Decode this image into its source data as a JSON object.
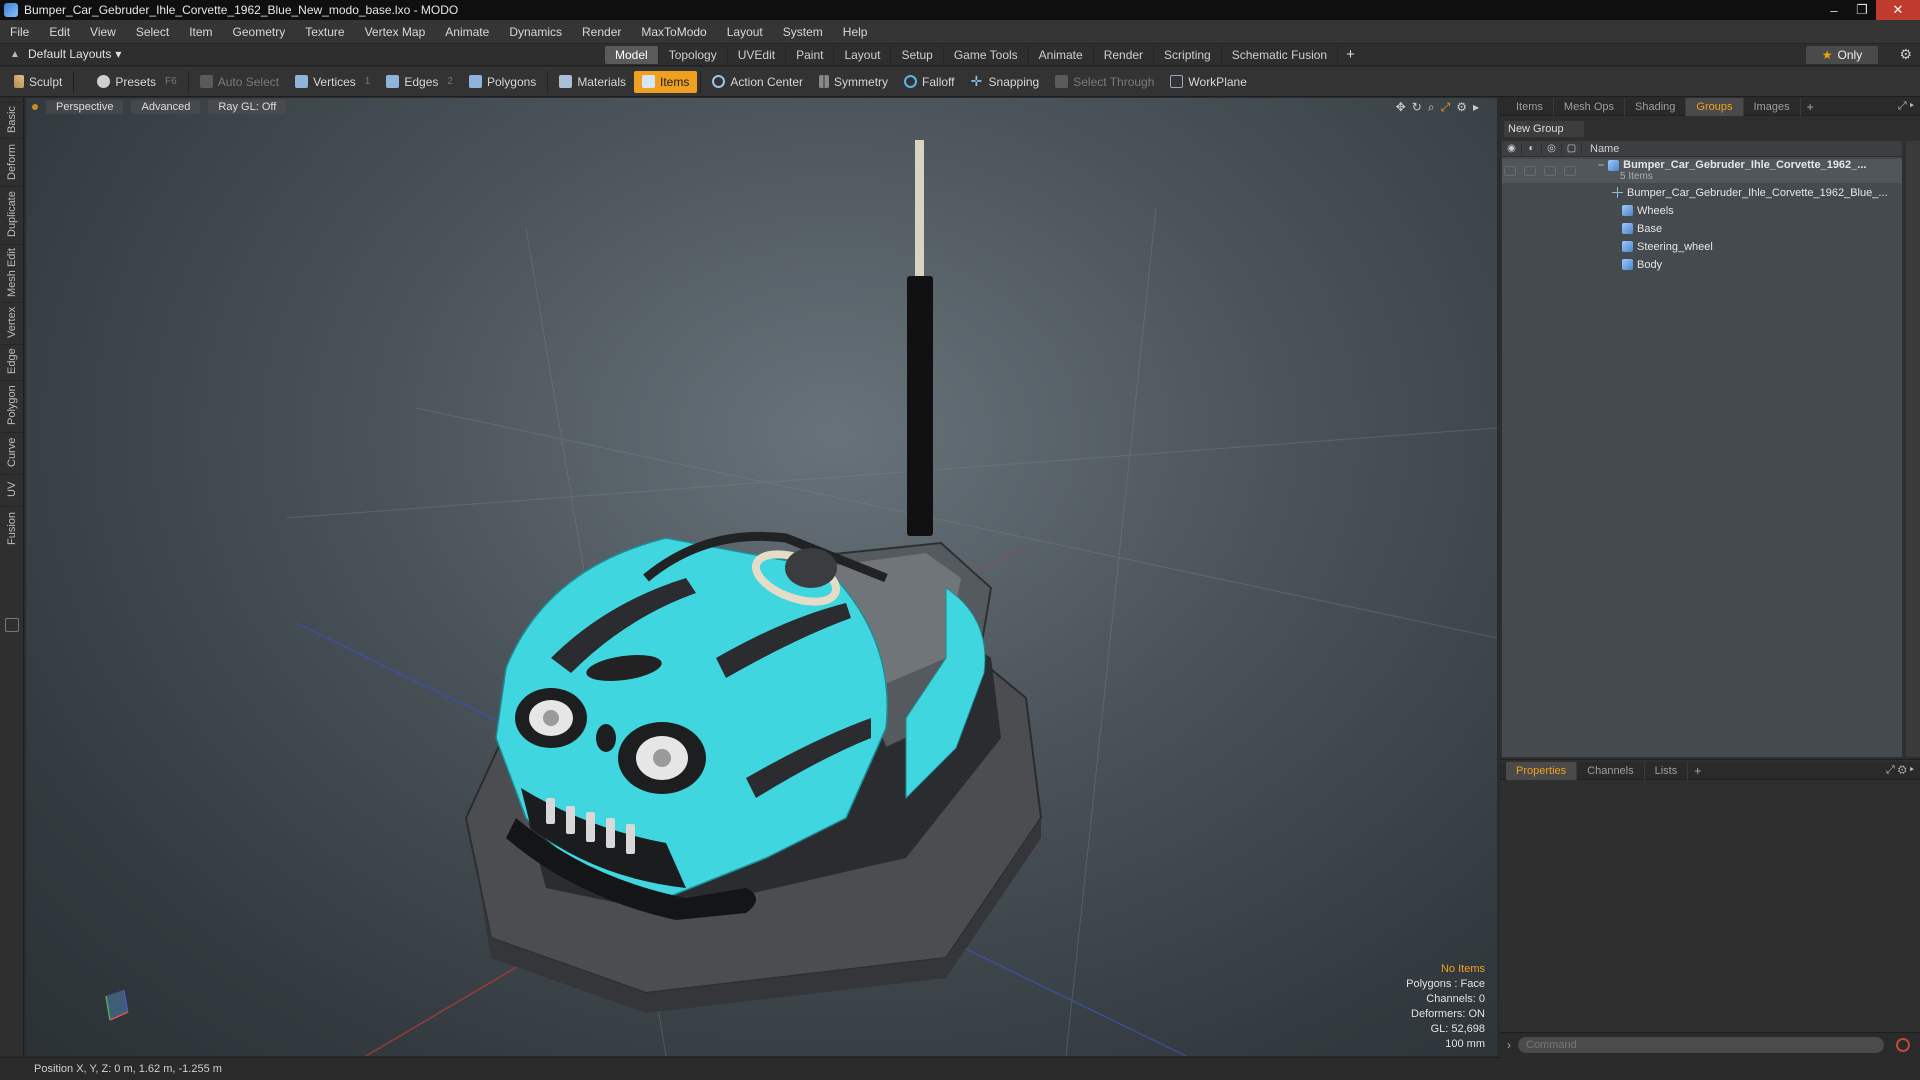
{
  "window": {
    "title": "Bumper_Car_Gebruder_Ihle_Corvette_1962_Blue_New_modo_base.lxo - MODO",
    "minimize": "‒",
    "maximize": "❐",
    "close": "✕"
  },
  "menu": [
    "File",
    "Edit",
    "View",
    "Select",
    "Item",
    "Geometry",
    "Texture",
    "Vertex Map",
    "Animate",
    "Dynamics",
    "Render",
    "MaxToModo",
    "Layout",
    "System",
    "Help"
  ],
  "layout_select": "Default Layouts",
  "tabs": [
    "Model",
    "Topology",
    "UVEdit",
    "Paint",
    "Layout",
    "Setup",
    "Game Tools",
    "Animate",
    "Render",
    "Scripting",
    "Schematic Fusion"
  ],
  "active_tab": "Model",
  "only_label": "Only",
  "toolbar": {
    "sculpt": "Sculpt",
    "presets": "Presets",
    "presets_key": "F6",
    "auto_select": "Auto Select",
    "vertices": "Vertices",
    "vertices_key": "1",
    "edges": "Edges",
    "edges_key": "2",
    "polygons": "Polygons",
    "materials": "Materials",
    "items": "Items",
    "action_center": "Action Center",
    "symmetry": "Symmetry",
    "falloff": "Falloff",
    "snapping": "Snapping",
    "select_through": "Select Through",
    "workplane": "WorkPlane"
  },
  "left_tabs": [
    "Basic",
    "Deform",
    "Duplicate",
    "Mesh Edit",
    "Vertex",
    "Edge",
    "Polygon",
    "Curve",
    "UV",
    "Fusion"
  ],
  "viewport": {
    "projection": "Perspective",
    "advanced": "Advanced",
    "raygl": "Ray GL: Off",
    "info": {
      "selection": "No Items",
      "polygons": "Polygons : Face",
      "channels": "Channels: 0",
      "deformers": "Deformers: ON",
      "gl": "GL: 52,698",
      "scale": "100 mm"
    }
  },
  "right_panel": {
    "top_tabs": [
      "Items",
      "Mesh Ops",
      "Shading",
      "Groups",
      "Images"
    ],
    "active_top_tab": "Groups",
    "new_group": "New Group",
    "name_col": "Name",
    "tree": {
      "root": "Bumper_Car_Gebruder_Ihle_Corvette_1962_...",
      "root_count": "5 Items",
      "children": [
        {
          "label": "Bumper_Car_Gebruder_Ihle_Corvette_1962_Blue_...",
          "icon": "locator-icon"
        },
        {
          "label": "Wheels",
          "icon": "mesh-icon"
        },
        {
          "label": "Base",
          "icon": "mesh-icon"
        },
        {
          "label": "Steering_wheel",
          "icon": "mesh-icon"
        },
        {
          "label": "Body",
          "icon": "mesh-icon"
        }
      ]
    },
    "bottom_tabs": [
      "Properties",
      "Channels",
      "Lists"
    ],
    "active_bottom_tab": "Properties",
    "command_placeholder": "Command"
  },
  "status": {
    "position": "Position X, Y, Z:  0 m, 1.62 m, -1.255 m"
  },
  "colors": {
    "accent": "#f0a020",
    "car_body": "#3fd6df"
  }
}
